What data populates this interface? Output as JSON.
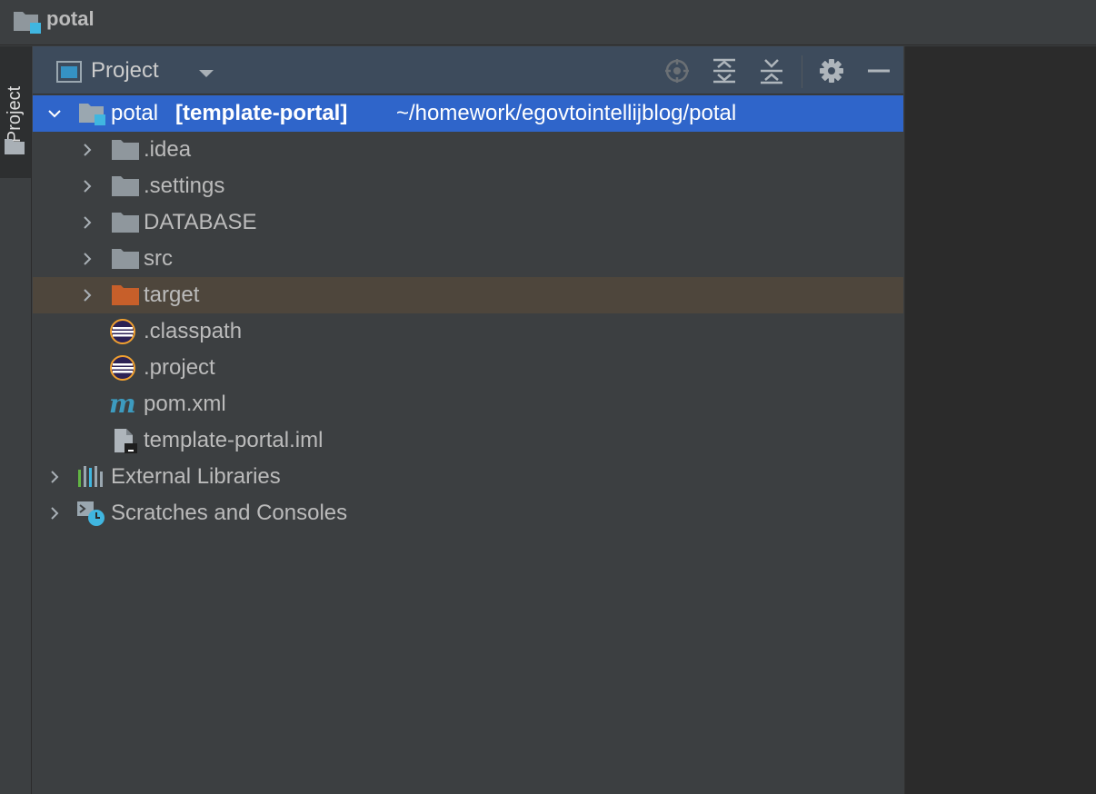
{
  "window": {
    "title": "potal"
  },
  "tool_stripe": {
    "tab_label": "Project"
  },
  "panel": {
    "title": "Project",
    "toolbar": {
      "locate_icon": "target-icon",
      "expand_icon": "expand-all-icon",
      "collapse_icon": "collapse-all-icon",
      "settings_icon": "gear-icon",
      "hide_icon": "minimize-icon"
    }
  },
  "tree": {
    "root": {
      "name": "potal",
      "module": "[template-portal]",
      "path": "~/homework/egovtointellijblog/potal"
    },
    "children": [
      {
        "label": ".idea",
        "icon": "folder-icon"
      },
      {
        "label": ".settings",
        "icon": "folder-icon"
      },
      {
        "label": "DATABASE",
        "icon": "folder-icon"
      },
      {
        "label": "src",
        "icon": "folder-icon"
      },
      {
        "label": "target",
        "icon": "excluded-folder-icon"
      },
      {
        "label": ".classpath",
        "icon": "eclipse-icon"
      },
      {
        "label": ".project",
        "icon": "eclipse-icon"
      },
      {
        "label": "pom.xml",
        "icon": "maven-icon"
      },
      {
        "label": "template-portal.iml",
        "icon": "iml-file-icon"
      }
    ],
    "external_libraries": "External Libraries",
    "scratches": "Scratches and Consoles"
  },
  "colors": {
    "selection": "#2f65ca",
    "excluded_row": "#4e463c",
    "excluded_folder": "#c75f2a",
    "folder": "#8f979d",
    "header": "#3d4b5c"
  }
}
